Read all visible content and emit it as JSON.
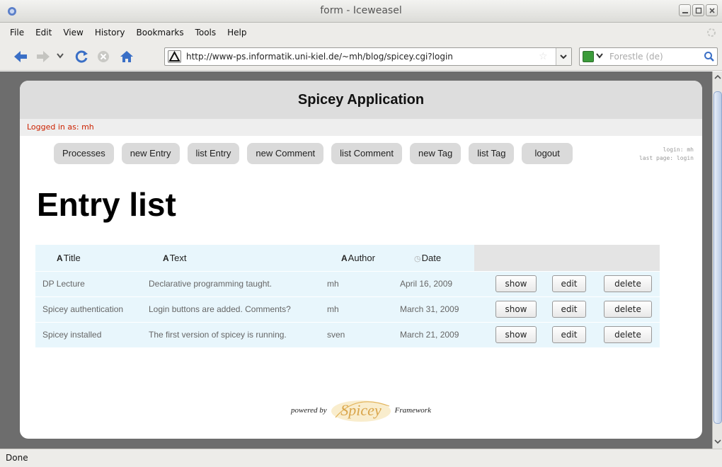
{
  "window": {
    "title": "form - Iceweasel"
  },
  "menubar": {
    "items": [
      {
        "label": "File"
      },
      {
        "label": "Edit"
      },
      {
        "label": "View"
      },
      {
        "label": "History"
      },
      {
        "label": "Bookmarks"
      },
      {
        "label": "Tools"
      },
      {
        "label": "Help"
      }
    ]
  },
  "navbar": {
    "url": "http://www-ps.informatik.uni-kiel.de/~mh/blog/spicey.cgi?login",
    "search_placeholder": "Forestle (de)",
    "icons": [
      "back-arrow-icon",
      "forward-arrow-icon",
      "history-dropdown-icon",
      "reload-icon",
      "stop-icon",
      "home-icon"
    ]
  },
  "page": {
    "app_title": "Spicey Application",
    "logged_in": "Logged in as: mh",
    "nav_buttons": [
      {
        "label": "Processes"
      },
      {
        "label": "new Entry"
      },
      {
        "label": "list Entry"
      },
      {
        "label": "new Comment"
      },
      {
        "label": "list Comment"
      },
      {
        "label": "new Tag"
      },
      {
        "label": "list Tag"
      },
      {
        "label": "logout"
      }
    ],
    "login_info": {
      "line1": "login: mh",
      "line2": "last page: login"
    },
    "heading": "Entry list",
    "table": {
      "columns": [
        {
          "glyph": "A",
          "label": "Title"
        },
        {
          "glyph": "A",
          "label": "Text"
        },
        {
          "glyph": "A",
          "label": "Author"
        },
        {
          "glyph": "◷",
          "label": "Date"
        }
      ],
      "rows": [
        {
          "title": "DP Lecture",
          "text": "Declarative programming taught.",
          "author": "mh",
          "date": "April 16, 2009"
        },
        {
          "title": "Spicey authentication",
          "text": "Login buttons are added. Comments?",
          "author": "mh",
          "date": "March 31, 2009"
        },
        {
          "title": "Spicey installed",
          "text": "The first version of spicey is running.",
          "author": "sven",
          "date": "March 21, 2009"
        }
      ],
      "row_actions": {
        "show": "show",
        "edit": "edit",
        "delete": "delete"
      }
    },
    "footer": {
      "powered_by": "powered by",
      "logo_text": "Spicey",
      "framework": "Framework"
    }
  },
  "status": {
    "text": "Done"
  },
  "colors": {
    "page_bg": "#6d6d6d",
    "header_bg": "#dddddd",
    "login_text": "#cc2200",
    "table_bg": "#e8f6fc",
    "logo_gold": "#d9a54a"
  }
}
